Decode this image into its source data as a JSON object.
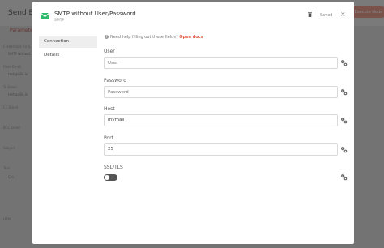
{
  "background": {
    "title": "Send Em",
    "tab": "Parameters",
    "top_button": "Execute Node",
    "labels": [
      "Credentials for S...",
      "From Email",
      "To Email",
      "CC Email",
      "BCC Email",
      "Subject",
      "Text",
      "HTML"
    ],
    "values": [
      "SMTP without...",
      "test@n8n.io",
      "test@n8n.io",
      "Cht"
    ]
  },
  "modal": {
    "title": "SMTP without User/Password",
    "subtitle": "SMTP",
    "saved_label": "Saved",
    "close_glyph": "×",
    "sidebar": [
      "Connection",
      "Details"
    ],
    "help": {
      "text": "Need help filling out these fields?",
      "link": "Open docs"
    },
    "fields": {
      "user": {
        "label": "User",
        "value": "",
        "placeholder": "User"
      },
      "password": {
        "label": "Password",
        "value": "",
        "placeholder": "Password"
      },
      "host": {
        "label": "Host",
        "value": "mymail"
      },
      "port": {
        "label": "Port",
        "value": "25"
      },
      "ssl": {
        "label": "SSL/TLS",
        "enabled": false
      }
    }
  },
  "colors": {
    "accent": "#e05a3c",
    "mail_icon": "#2fba6c"
  },
  "icons": [
    "mail-icon",
    "trash-icon",
    "close-icon",
    "gear-icon",
    "help-icon"
  ]
}
